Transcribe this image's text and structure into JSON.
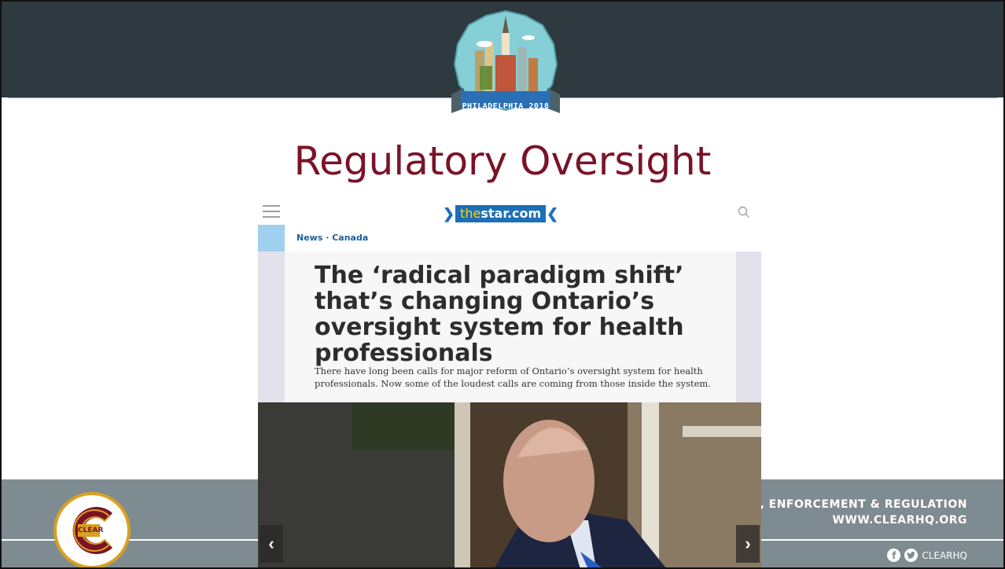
{
  "slide": {
    "title": "Regulatory Oversight",
    "badge_text": "PHILADELPHIA 2018"
  },
  "footer": {
    "tagline": "URE, ENFORCEMENT & REGULATION",
    "website": "WWW.CLEARHQ.ORG",
    "social_handle": "CLEARHQ",
    "logo_text": "CLEAR"
  },
  "article": {
    "site_name_prefix": "the",
    "site_name_main": "star.com",
    "breadcrumb": "News · Canada",
    "headline": "The ‘radical paradigm shift’ that’s changing Ontario’s oversight system for health professionals",
    "dek": "There have long been calls for major reform of Ontario’s oversight system for health professionals. Now some of the loudest calls are coming from those inside the system.",
    "prev_arrow": "‹",
    "next_arrow": "›"
  },
  "icons": [
    "hamburger-menu-icon",
    "search-icon",
    "facebook-icon",
    "twitter-icon",
    "chevron-left-icon",
    "chevron-right-icon"
  ],
  "colors": {
    "title": "#7a1328",
    "top_bar": "#2e3a40",
    "footer": "#7e8c91",
    "star_blue": "#1d6fb8",
    "clear_gold": "#d8a11f"
  }
}
